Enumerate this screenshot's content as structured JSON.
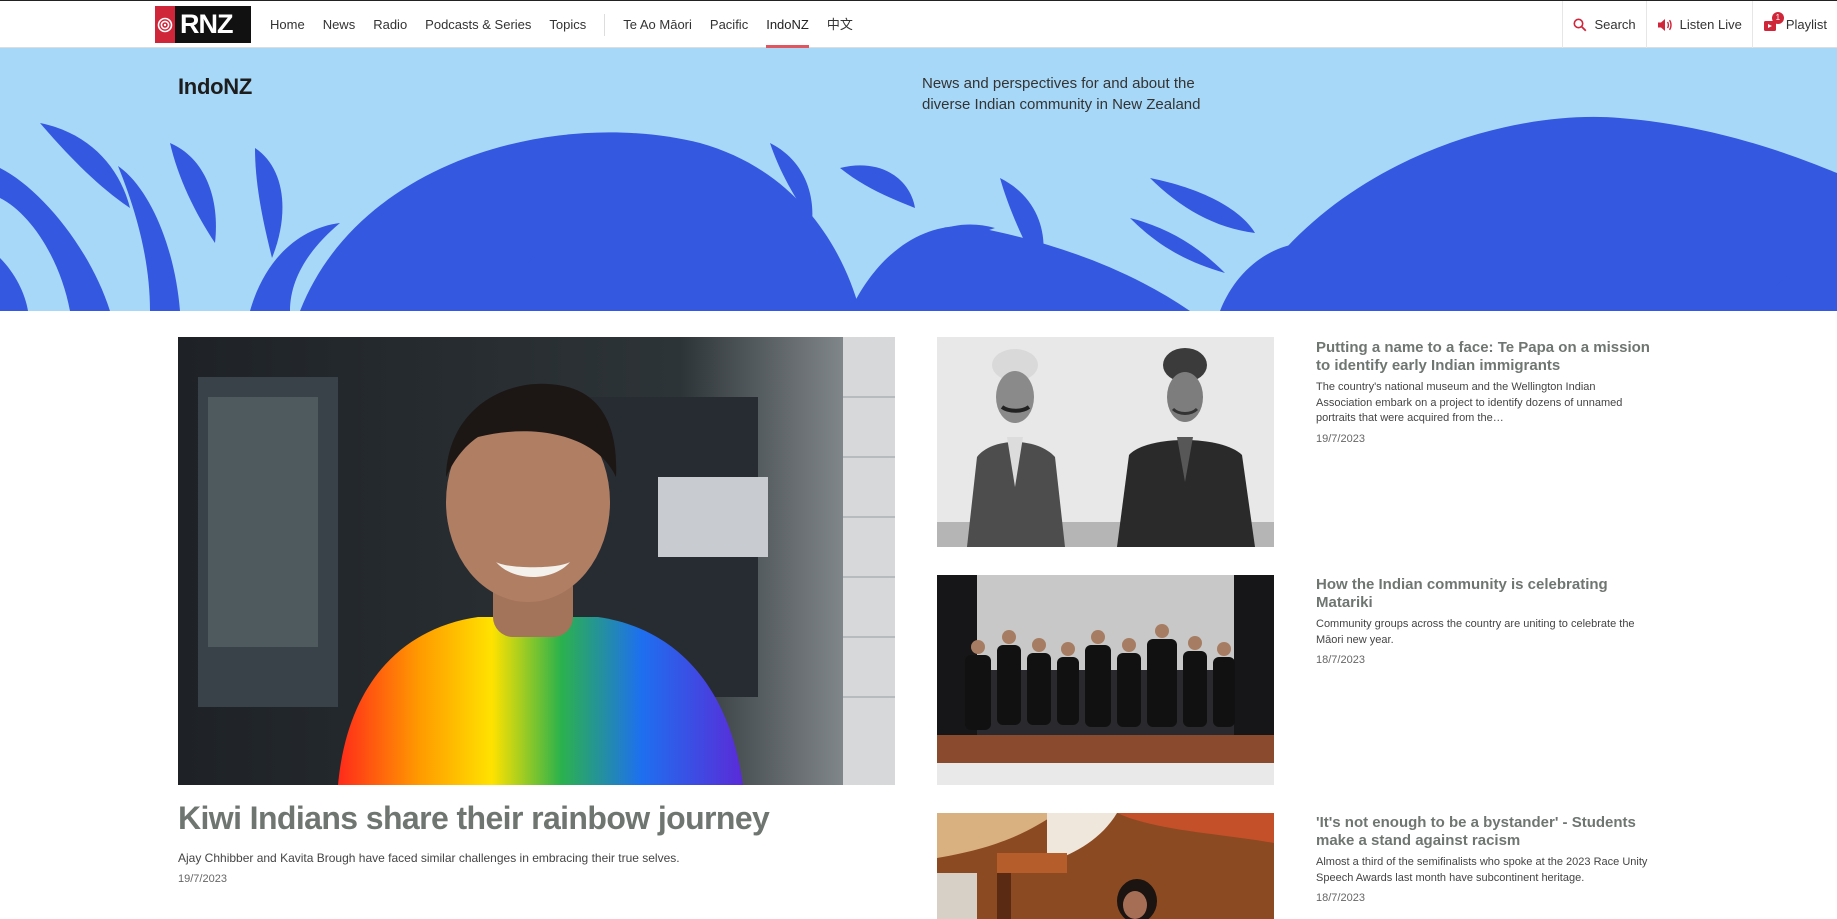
{
  "brand": {
    "logo_text": "RNZ",
    "accent": "#d0263a"
  },
  "nav": {
    "items": [
      {
        "label": "Home"
      },
      {
        "label": "News"
      },
      {
        "label": "Radio"
      },
      {
        "label": "Podcasts & Series"
      },
      {
        "label": "Topics"
      },
      {
        "label": "Te Ao Māori"
      },
      {
        "label": "Pacific"
      },
      {
        "label": "IndoNZ"
      },
      {
        "label": "中文"
      }
    ],
    "active": "IndoNZ"
  },
  "utilities": {
    "search": {
      "label": "Search",
      "icon": "search-icon"
    },
    "listen": {
      "label": "Listen Live",
      "icon": "speaker-icon"
    },
    "playlist": {
      "label": "Playlist",
      "icon": "playlist-icon",
      "count": "1"
    }
  },
  "hero": {
    "title": "IndoNZ",
    "description": "News and perspectives for and about the diverse Indian community in New Zealand",
    "bg_color": "#a8d8f8",
    "pattern_color": "#3558e0"
  },
  "feature": {
    "title": "Kiwi Indians share their rainbow journey",
    "summary": "Ajay Chhibber and Kavita Brough have faced similar challenges in embracing their true selves.",
    "date": "19/7/2023",
    "image": "man-in-rainbow-shirt-photo"
  },
  "stories": [
    {
      "title": "Putting a name to a face: Te Papa on a mission to identify early Indian immigrants",
      "summary": "The country's national museum and the Wellington Indian Association embark on a project to identify dozens of unnamed portraits that were acquired from the…",
      "date": "19/7/2023",
      "image": "two-men-archival-portrait-photo"
    },
    {
      "title": "How the Indian community is celebrating Matariki",
      "summary": "Community groups across the country are uniting to celebrate the Māori new year.",
      "date": "18/7/2023",
      "image": "group-performance-on-stage-photo"
    },
    {
      "title": "'It's not enough to be a bystander' - Students make a stand against racism",
      "summary": "Almost a third of the semifinalists who spoke at the 2023 Race Unity Speech Awards last month have subcontinent heritage.",
      "date": "18/7/2023",
      "image": "student-speaker-marae-photo"
    }
  ]
}
